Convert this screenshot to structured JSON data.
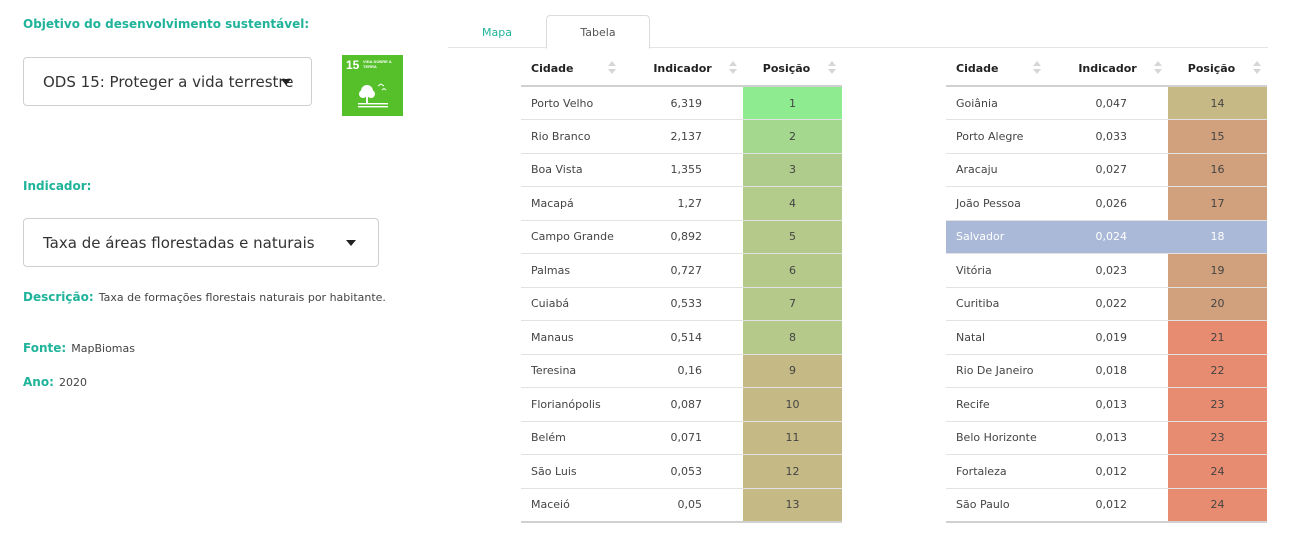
{
  "objective": {
    "label": "Objetivo do desenvolvimento sustentável:",
    "selected": "ODS 15: Proteger a vida terrestre",
    "badge_number": "15",
    "badge_title": "VIDA SOBRE A TERRA",
    "badge_color": "#56c02b"
  },
  "indicator": {
    "label": "Indicador:",
    "selected": "Taxa de áreas florestadas e naturais"
  },
  "description": {
    "label": "Descrição:",
    "value": "Taxa de formações florestais naturais por habitante."
  },
  "source": {
    "label": "Fonte:",
    "value": "MapBiomas"
  },
  "year": {
    "label": "Ano:",
    "value": "2020"
  },
  "tabs": [
    {
      "label": "Mapa",
      "active": false
    },
    {
      "label": "Tabela",
      "active": true
    }
  ],
  "columns": [
    "Cidade",
    "Indicador",
    "Posição"
  ],
  "table_left": [
    {
      "city": "Porto Velho",
      "value": "6,319",
      "pos": "1",
      "color": "#8feb8f"
    },
    {
      "city": "Rio Branco",
      "value": "2,137",
      "pos": "2",
      "color": "#a3d88e"
    },
    {
      "city": "Boa Vista",
      "value": "1,355",
      "pos": "3",
      "color": "#b0cc8c"
    },
    {
      "city": "Macapá",
      "value": "1,27",
      "pos": "4",
      "color": "#b3cb8b"
    },
    {
      "city": "Campo Grande",
      "value": "0,892",
      "pos": "5",
      "color": "#b5ca8a"
    },
    {
      "city": "Palmas",
      "value": "0,727",
      "pos": "6",
      "color": "#b5ca8a"
    },
    {
      "city": "Cuiabá",
      "value": "0,533",
      "pos": "7",
      "color": "#b5ca8a"
    },
    {
      "city": "Manaus",
      "value": "0,514",
      "pos": "8",
      "color": "#b5ca8a"
    },
    {
      "city": "Teresina",
      "value": "0,16",
      "pos": "9",
      "color": "#c5b985"
    },
    {
      "city": "Florianópolis",
      "value": "0,087",
      "pos": "10",
      "color": "#c5b985"
    },
    {
      "city": "Belém",
      "value": "0,071",
      "pos": "11",
      "color": "#c5b985"
    },
    {
      "city": "São Luis",
      "value": "0,053",
      "pos": "12",
      "color": "#c5b985"
    },
    {
      "city": "Maceió",
      "value": "0,05",
      "pos": "13",
      "color": "#c5b985"
    }
  ],
  "table_right": [
    {
      "city": "Goiânia",
      "value": "0,047",
      "pos": "14",
      "color": "#c6b985",
      "highlight": false
    },
    {
      "city": "Porto Alegre",
      "value": "0,033",
      "pos": "15",
      "color": "#d0a17c",
      "highlight": false
    },
    {
      "city": "Aracaju",
      "value": "0,027",
      "pos": "16",
      "color": "#d0a17c",
      "highlight": false
    },
    {
      "city": "João Pessoa",
      "value": "0,026",
      "pos": "17",
      "color": "#d0a17c",
      "highlight": false
    },
    {
      "city": "Salvador",
      "value": "0,024",
      "pos": "18",
      "color": "#aab9d7",
      "highlight": true
    },
    {
      "city": "Vitória",
      "value": "0,023",
      "pos": "19",
      "color": "#d0a17c",
      "highlight": false
    },
    {
      "city": "Curitiba",
      "value": "0,022",
      "pos": "20",
      "color": "#d0a17c",
      "highlight": false
    },
    {
      "city": "Natal",
      "value": "0,019",
      "pos": "21",
      "color": "#e88c71",
      "highlight": false
    },
    {
      "city": "Rio De Janeiro",
      "value": "0,018",
      "pos": "22",
      "color": "#e88c71",
      "highlight": false
    },
    {
      "city": "Recife",
      "value": "0,013",
      "pos": "23",
      "color": "#e88c71",
      "highlight": false
    },
    {
      "city": "Belo Horizonte",
      "value": "0,013",
      "pos": "23",
      "color": "#e88c71",
      "highlight": false
    },
    {
      "city": "Fortaleza",
      "value": "0,012",
      "pos": "24",
      "color": "#e88c71",
      "highlight": false
    },
    {
      "city": "São Paulo",
      "value": "0,012",
      "pos": "24",
      "color": "#e88c71",
      "highlight": false
    }
  ]
}
